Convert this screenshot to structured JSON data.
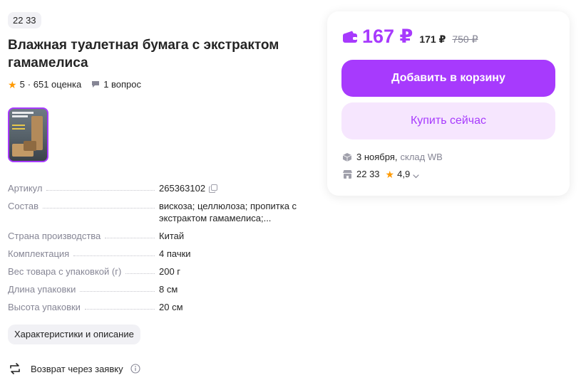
{
  "seller_badge": "22 33",
  "product": {
    "title": "Влажная туалетная бумага с экстрактом гамамелиса",
    "rating": "5",
    "reviews": "· 651 оценка",
    "questions": "1 вопрос"
  },
  "thumbnail": {
    "label": "product-photo"
  },
  "specs": [
    {
      "name": "Артикул",
      "value": "265363102"
    },
    {
      "name": "Состав",
      "value": "вискоза; целлюлоза; пропитка с экстрактом гамамелиса;..."
    },
    {
      "name": "Страна производства",
      "value": "Китай"
    },
    {
      "name": "Комплектация",
      "value": "4 пачки"
    },
    {
      "name": "Вес товара с упаковкой (г)",
      "value": "200 г"
    },
    {
      "name": "Длина упаковки",
      "value": "8 см"
    },
    {
      "name": "Высота упаковки",
      "value": "20 см"
    }
  ],
  "chars_button": "Характеристики и описание",
  "return_text": "Возврат через заявку",
  "card": {
    "price": "167 ₽",
    "price_wallet": "171 ₽",
    "price_old": "750 ₽",
    "cart_button": "Добавить в корзину",
    "buy_button": "Купить сейчас",
    "delivery_date": "3 ноября,",
    "delivery_source": "склад WB",
    "seller_name": "22 33",
    "seller_rating": "4,9"
  },
  "colors": {
    "accent": "#a73afd",
    "accent_light": "#f6e6fe",
    "star": "#ff9a00",
    "muted": "#868695"
  },
  "icons": [
    "star-icon",
    "question-icon",
    "copy-icon",
    "return-icon",
    "info-icon",
    "wallet-icon",
    "box-icon",
    "store-icon",
    "chevron-down-icon"
  ]
}
